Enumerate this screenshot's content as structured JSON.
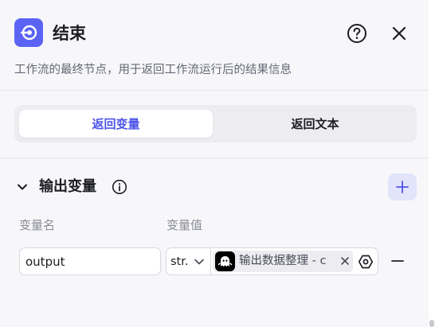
{
  "header": {
    "title": "结束",
    "description": "工作流的最终节点，用于返回工作流运行后的结果信息",
    "node_icon": "end-node-icon",
    "accent": "#5b63f5"
  },
  "tabs": [
    {
      "label": "返回变量",
      "active": true
    },
    {
      "label": "返回文本",
      "active": false
    }
  ],
  "output_section": {
    "title": "输出变量",
    "column_name": "变量名",
    "column_value": "变量值"
  },
  "rows": [
    {
      "name": "output",
      "type": "str.",
      "reference": "输出数据整理 - c"
    }
  ],
  "colors": {
    "active_tab_text": "#4d53e8",
    "add_button_bg": "#e2e4fb"
  }
}
